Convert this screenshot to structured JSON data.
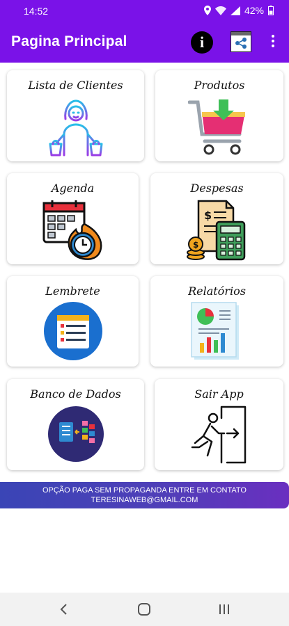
{
  "status_bar": {
    "time": "14:52",
    "battery": "42%"
  },
  "app_bar": {
    "title": "Pagina Principal"
  },
  "menu": [
    {
      "label": "Lista de Clientes",
      "icon": "clients-icon"
    },
    {
      "label": "Produtos",
      "icon": "shopping-cart-icon"
    },
    {
      "label": "Agenda",
      "icon": "calendar-clock-icon"
    },
    {
      "label": "Despesas",
      "icon": "expenses-calculator-icon"
    },
    {
      "label": "Lembrete",
      "icon": "reminder-list-icon"
    },
    {
      "label": "Relatórios",
      "icon": "report-chart-icon"
    },
    {
      "label": "Banco de Dados",
      "icon": "database-icon"
    },
    {
      "label": "Sair App",
      "icon": "exit-door-icon"
    }
  ],
  "promo": {
    "line1": "OPÇÃO PAGA  SEM PROPAGANDA ENTRE EM CONTATO",
    "line2": "TERESINAWEB@GMAIL.COM"
  },
  "colors": {
    "app_bar": "#7a12e8",
    "promo_start": "#3a45b6",
    "promo_end": "#6a2fc0"
  }
}
